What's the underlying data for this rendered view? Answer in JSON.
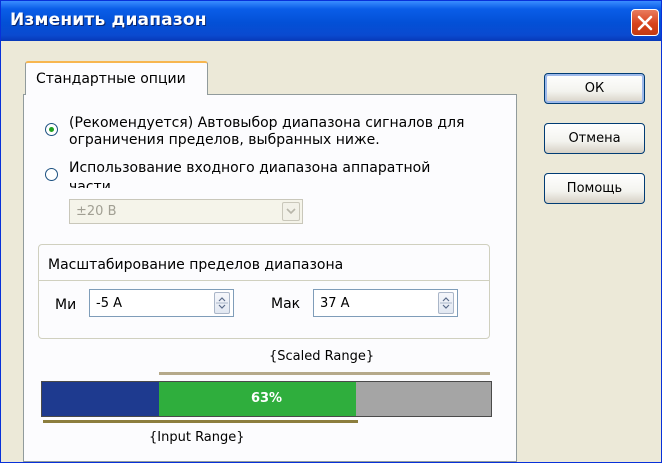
{
  "window": {
    "title": "Изменить диапазон"
  },
  "tabs": [
    {
      "label": "Стандартные опции"
    }
  ],
  "options": {
    "recommended": {
      "line1": "(Рекомендуется) Автовыбор диапазона сигналов для",
      "line2": "ограничения пределов, выбранных ниже.",
      "selected": true
    },
    "hardware": {
      "line1": "Использование входного диапазона аппаратной",
      "line2": "части",
      "selected": false
    }
  },
  "hardware_range": {
    "value": "±20 В"
  },
  "scaling": {
    "title": "Масштабирование пределов диапазона",
    "min_label": "Ми",
    "min_value": "-5 А",
    "max_label": "Мак",
    "max_value": "37 А"
  },
  "range_bar": {
    "scaled_label": "{Scaled Range}",
    "input_label": "{Input Range}",
    "percent_text": "63%",
    "input_start": 0,
    "input_end": 0.7,
    "scaled_start": 0.26,
    "scaled_end": 1.0,
    "colors": {
      "input_only": "#1e3a8f",
      "overlap": "#2fae3d",
      "scaled_only": "#a5a5a5"
    }
  },
  "buttons": {
    "ok": "ОК",
    "cancel": "Отмена",
    "help": "Помощь"
  }
}
